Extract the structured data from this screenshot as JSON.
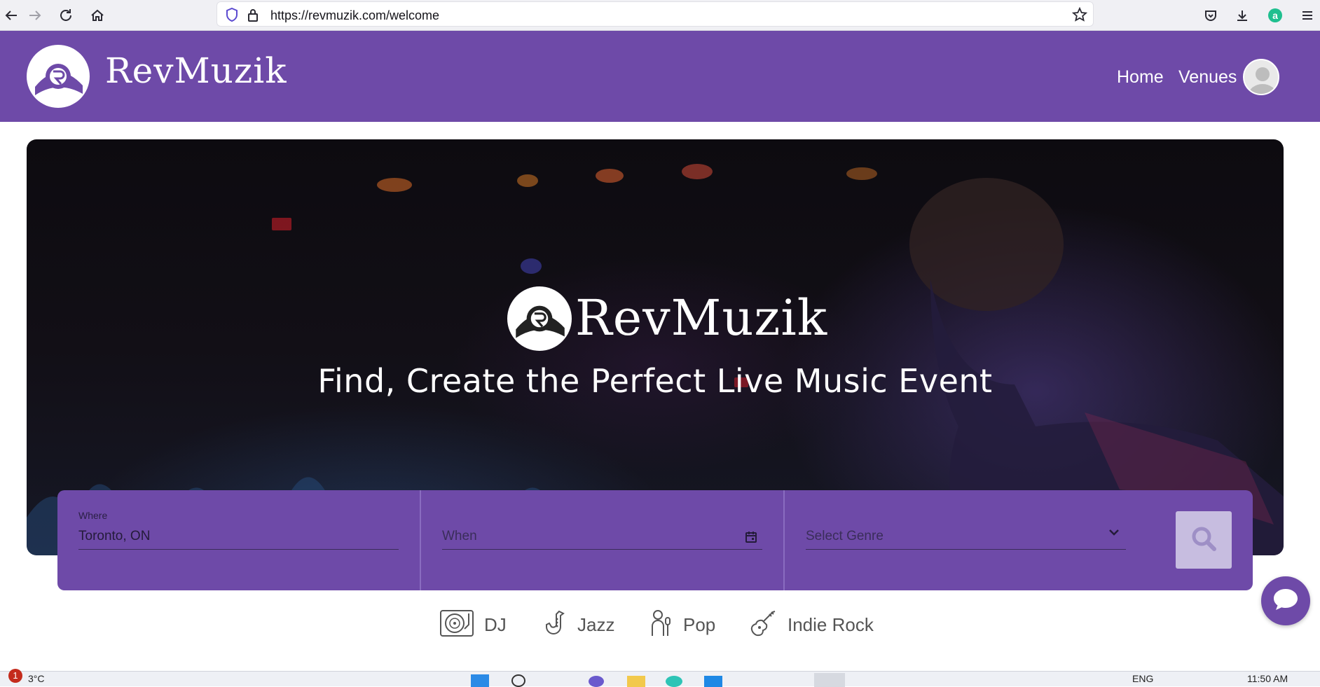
{
  "browser": {
    "url": "https://revmuzik.com/welcome"
  },
  "header": {
    "brand": "RevMuzik",
    "nav": [
      {
        "label": "Home"
      },
      {
        "label": "Venues"
      }
    ]
  },
  "hero": {
    "brand": "RevMuzik",
    "tagline": "Find, Create the Perfect Live Music Event"
  },
  "search": {
    "where_label": "Where",
    "where_value": "Toronto, ON",
    "when_placeholder": "When",
    "genre_placeholder": "Select Genre"
  },
  "genres": [
    {
      "label": "DJ",
      "icon": "turntable-icon"
    },
    {
      "label": "Jazz",
      "icon": "saxophone-icon"
    },
    {
      "label": "Pop",
      "icon": "microphone-singer-icon"
    },
    {
      "label": "Indie Rock",
      "icon": "electric-guitar-icon"
    }
  ],
  "taskbar": {
    "weather": "3°C",
    "badge": "1",
    "lang": "ENG",
    "time": "11:50 AM"
  },
  "colors": {
    "brand_purple": "#6e4aa8",
    "search_button": "#c7bde0"
  }
}
